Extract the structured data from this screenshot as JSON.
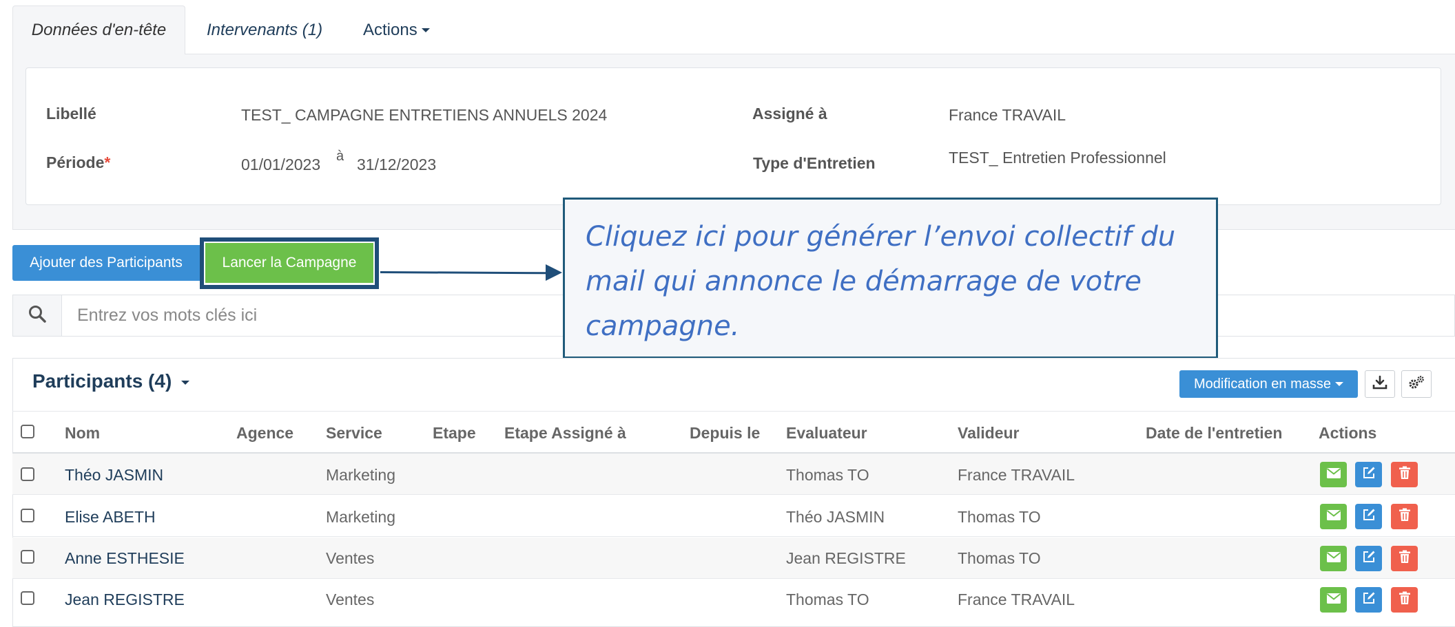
{
  "tabs": {
    "header_data": "Données d'en-tête",
    "intervenants": "Intervenants (1)",
    "actions": "Actions"
  },
  "header": {
    "libelle_label": "Libellé",
    "libelle_value": "TEST_ CAMPAGNE ENTRETIENS ANNUELS 2024",
    "periode_label": "Période",
    "required_mark": "*",
    "periode_start": "01/01/2023",
    "periode_sep": "à",
    "periode_end": "31/12/2023",
    "assigne_label": "Assigné à",
    "assigne_value": "France TRAVAIL",
    "type_label": "Type d'Entretien",
    "type_value": "TEST_ Entretien Professionnel"
  },
  "buttons": {
    "add_participants": "Ajouter des Participants",
    "launch_campaign": "Lancer la Campagne"
  },
  "callout": {
    "text": "Cliquez ici pour générer l’envoi collectif du mail qui annonce le démarrage de votre campagne."
  },
  "search": {
    "placeholder": "Entrez vos mots clés ici"
  },
  "participants": {
    "title": "Participants (4)",
    "mass_edit": "Modification en masse",
    "columns": {
      "nom": "Nom",
      "agence": "Agence",
      "service": "Service",
      "etape": "Etape",
      "etape_assigne": "Etape Assigné à",
      "depuis": "Depuis le",
      "evaluateur": "Evaluateur",
      "valideur": "Valideur",
      "date": "Date de l'entretien",
      "actions": "Actions"
    },
    "rows": [
      {
        "nom": "Théo JASMIN",
        "service": "Marketing",
        "evaluateur": "Thomas TO",
        "valideur": "France TRAVAIL"
      },
      {
        "nom": "Elise ABETH",
        "service": "Marketing",
        "evaluateur": "Théo JASMIN",
        "valideur": "Thomas TO"
      },
      {
        "nom": "Anne ESTHESIE",
        "service": "Ventes",
        "evaluateur": "Jean REGISTRE",
        "valideur": "Thomas TO"
      },
      {
        "nom": "Jean REGISTRE",
        "service": "Ventes",
        "evaluateur": "Thomas TO",
        "valideur": "France TRAVAIL"
      }
    ]
  },
  "icons": {
    "search": "search-icon",
    "download": "download-icon",
    "settings": "gears-icon",
    "mail": "envelope-icon",
    "edit": "edit-icon",
    "delete": "trash-icon"
  },
  "colors": {
    "primary": "#3a8fd6",
    "success": "#6cc04a",
    "danger": "#f0604d",
    "callout_border": "#1f5a7a",
    "callout_text": "#3f6fc3",
    "highlight_frame": "#1f4e79"
  }
}
